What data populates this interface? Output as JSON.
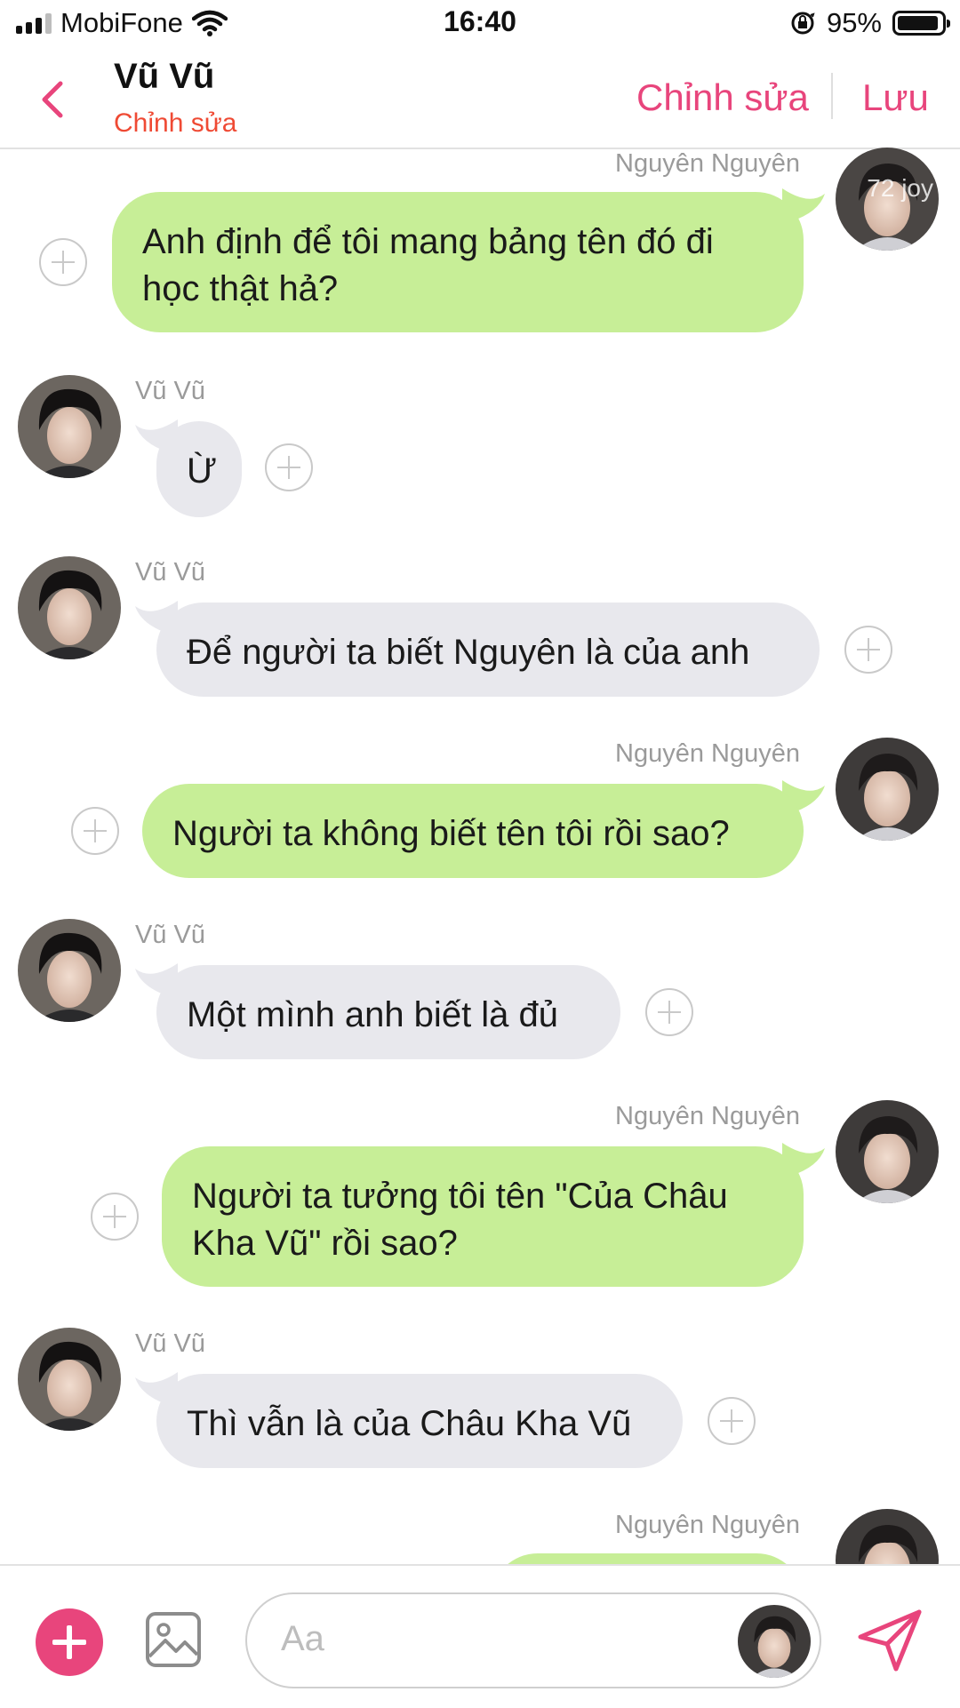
{
  "status_bar": {
    "carrier": "MobiFone",
    "time": "16:40",
    "battery_percent": "95%",
    "battery_level": 0.95
  },
  "header": {
    "title": "Vũ Vũ",
    "subtitle": "Chỉnh sửa",
    "edit_label": "Chỉnh sửa",
    "save_label": "Lưu"
  },
  "messages": [
    {
      "sender": "Nguyên Nguyên",
      "side": "right",
      "text": "Anh định để tôi mang bảng tên đó đi học thật hả?",
      "watermark": "72 joy"
    },
    {
      "sender": "Vũ Vũ",
      "side": "left",
      "text": "Ừ"
    },
    {
      "sender": "Vũ Vũ",
      "side": "left",
      "text": "Để người ta biết Nguyên là của anh"
    },
    {
      "sender": "Nguyên Nguyên",
      "side": "right",
      "text": "Người ta không biết tên tôi rồi sao?"
    },
    {
      "sender": "Vũ Vũ",
      "side": "left",
      "text": "Một mình anh biết là đủ"
    },
    {
      "sender": "Nguyên Nguyên",
      "side": "right",
      "text": "Người ta tưởng tôi tên \"Của Châu Kha Vũ\" rồi sao?"
    },
    {
      "sender": "Vũ Vũ",
      "side": "left",
      "text": "Thì vẫn là của Châu Kha Vũ"
    },
    {
      "sender": "Nguyên Nguyên",
      "side": "right",
      "text": ""
    }
  ],
  "composer": {
    "placeholder": "Aa",
    "icons": [
      "add-icon",
      "image-icon",
      "send-icon"
    ]
  },
  "colors": {
    "accent": "#e8457c",
    "subtitle": "#ef4a34",
    "outgoing_bubble": "#c7ee97",
    "incoming_bubble": "#e8e8ed"
  }
}
